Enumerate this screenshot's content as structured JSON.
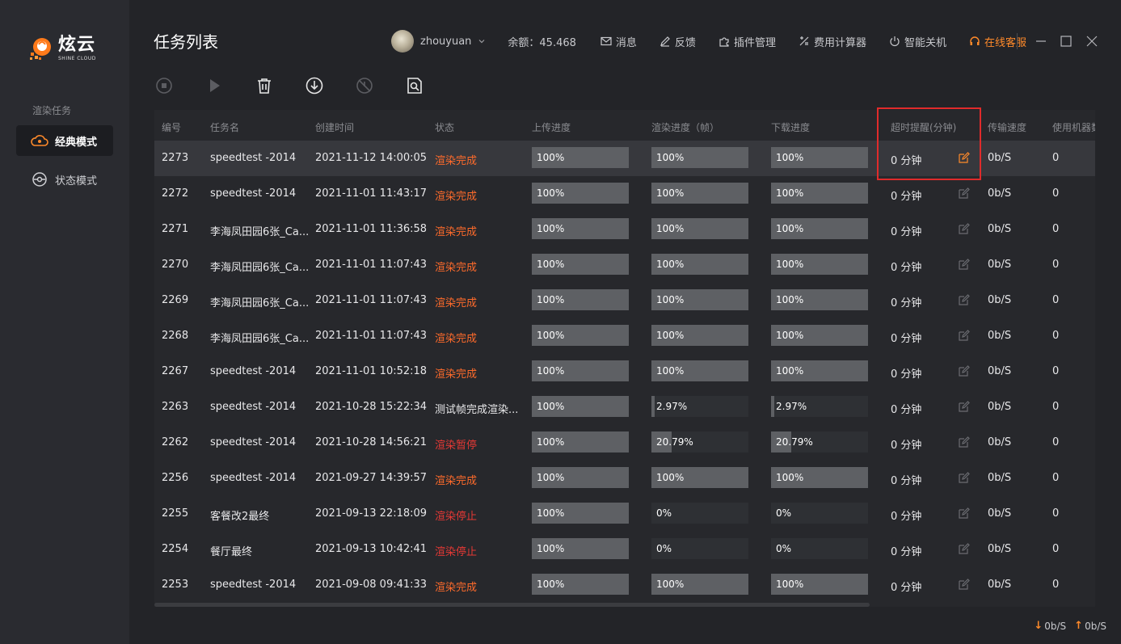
{
  "brand": {
    "name_cn": "炫云",
    "name_en": "SHINE CLOUD"
  },
  "sidebar": {
    "section_label": "渲染任务",
    "items": [
      {
        "label": "经典模式",
        "icon": "cloud-icon",
        "active": true
      },
      {
        "label": "状态模式",
        "icon": "dashboard-icon",
        "active": false
      }
    ]
  },
  "header": {
    "title": "任务列表",
    "user": "zhouyuan",
    "balance": "余额：45.468",
    "nav": [
      {
        "label": "消息",
        "icon": "mail-icon"
      },
      {
        "label": "反馈",
        "icon": "pen-icon"
      },
      {
        "label": "插件管理",
        "icon": "puzzle-icon"
      },
      {
        "label": "费用计算器",
        "icon": "calculator-icon"
      },
      {
        "label": "智能关机",
        "icon": "power-icon"
      },
      {
        "label": "在线客服",
        "icon": "headset-icon"
      }
    ],
    "accent_color": "#ff8a2a"
  },
  "toolbar": [
    "stop-icon",
    "play-icon",
    "trash-icon",
    "download-icon",
    "disabled-icon",
    "search-file-icon"
  ],
  "table": {
    "columns": [
      "编号",
      "任务名",
      "创建时间",
      "状态",
      "上传进度",
      "渲染进度（帧）",
      "下载进度",
      "超时提醒(分钟)",
      "传输速度",
      "使用机器数"
    ],
    "rows": [
      {
        "id": "2273",
        "name": "speedtest -2014",
        "created": "2021-11-12 14:00:05",
        "status": "渲染完成",
        "status_type": "done",
        "upload": "100%",
        "upload_pct": 100,
        "render": "100%",
        "render_pct": 100,
        "download": "100%",
        "download_pct": 100,
        "timeout": "0 分钟",
        "speed": "0b/S",
        "machines": "0",
        "selected": true
      },
      {
        "id": "2272",
        "name": "speedtest -2014",
        "created": "2021-11-01 11:43:17",
        "status": "渲染完成",
        "status_type": "done",
        "upload": "100%",
        "upload_pct": 100,
        "render": "100%",
        "render_pct": 100,
        "download": "100%",
        "download_pct": 100,
        "timeout": "0 分钟",
        "speed": "0b/S",
        "machines": "0"
      },
      {
        "id": "2271",
        "name": "李海凤田园6张_Ca...",
        "created": "2021-11-01 11:36:58",
        "status": "渲染完成",
        "status_type": "done",
        "upload": "100%",
        "upload_pct": 100,
        "render": "100%",
        "render_pct": 100,
        "download": "100%",
        "download_pct": 100,
        "timeout": "0 分钟",
        "speed": "0b/S",
        "machines": "0"
      },
      {
        "id": "2270",
        "name": "李海凤田园6张_Ca...",
        "created": "2021-11-01 11:07:43",
        "status": "渲染完成",
        "status_type": "done",
        "upload": "100%",
        "upload_pct": 100,
        "render": "100%",
        "render_pct": 100,
        "download": "100%",
        "download_pct": 100,
        "timeout": "0 分钟",
        "speed": "0b/S",
        "machines": "0"
      },
      {
        "id": "2269",
        "name": "李海凤田园6张_Ca...",
        "created": "2021-11-01 11:07:43",
        "status": "渲染完成",
        "status_type": "done",
        "upload": "100%",
        "upload_pct": 100,
        "render": "100%",
        "render_pct": 100,
        "download": "100%",
        "download_pct": 100,
        "timeout": "0 分钟",
        "speed": "0b/S",
        "machines": "0"
      },
      {
        "id": "2268",
        "name": "李海凤田园6张_Ca...",
        "created": "2021-11-01 11:07:43",
        "status": "渲染完成",
        "status_type": "done",
        "upload": "100%",
        "upload_pct": 100,
        "render": "100%",
        "render_pct": 100,
        "download": "100%",
        "download_pct": 100,
        "timeout": "0 分钟",
        "speed": "0b/S",
        "machines": "0"
      },
      {
        "id": "2267",
        "name": "speedtest -2014",
        "created": "2021-11-01 10:52:18",
        "status": "渲染完成",
        "status_type": "done",
        "upload": "100%",
        "upload_pct": 100,
        "render": "100%",
        "render_pct": 100,
        "download": "100%",
        "download_pct": 100,
        "timeout": "0 分钟",
        "speed": "0b/S",
        "machines": "0"
      },
      {
        "id": "2263",
        "name": "speedtest -2014",
        "created": "2021-10-28 15:22:34",
        "status": "测试帧完成渲染...",
        "status_type": "other",
        "upload": "100%",
        "upload_pct": 100,
        "render": "2.97%",
        "render_pct": 2.97,
        "download": "2.97%",
        "download_pct": 2.97,
        "timeout": "0 分钟",
        "speed": "0b/S",
        "machines": "0"
      },
      {
        "id": "2262",
        "name": "speedtest -2014",
        "created": "2021-10-28 14:56:21",
        "status": "渲染暂停",
        "status_type": "stop",
        "upload": "100%",
        "upload_pct": 100,
        "render": "20.79%",
        "render_pct": 20.79,
        "download": "20.79%",
        "download_pct": 20.79,
        "timeout": "0 分钟",
        "speed": "0b/S",
        "machines": "0"
      },
      {
        "id": "2256",
        "name": "speedtest -2014",
        "created": "2021-09-27 14:39:57",
        "status": "渲染完成",
        "status_type": "done",
        "upload": "100%",
        "upload_pct": 100,
        "render": "100%",
        "render_pct": 100,
        "download": "100%",
        "download_pct": 100,
        "timeout": "0 分钟",
        "speed": "0b/S",
        "machines": "0"
      },
      {
        "id": "2255",
        "name": "客餐改2最终",
        "created": "2021-09-13 22:18:09",
        "status": "渲染停止",
        "status_type": "stop",
        "upload": "100%",
        "upload_pct": 100,
        "render": "0%",
        "render_pct": 0,
        "download": "0%",
        "download_pct": 0,
        "timeout": "0 分钟",
        "speed": "0b/S",
        "machines": "0"
      },
      {
        "id": "2254",
        "name": "餐厅最终",
        "created": "2021-09-13 10:42:41",
        "status": "渲染停止",
        "status_type": "stop",
        "upload": "100%",
        "upload_pct": 100,
        "render": "0%",
        "render_pct": 0,
        "download": "0%",
        "download_pct": 0,
        "timeout": "0 分钟",
        "speed": "0b/S",
        "machines": "0"
      },
      {
        "id": "2253",
        "name": "speedtest -2014",
        "created": "2021-09-08 09:41:33",
        "status": "渲染完成",
        "status_type": "done",
        "upload": "100%",
        "upload_pct": 100,
        "render": "100%",
        "render_pct": 100,
        "download": "100%",
        "download_pct": 100,
        "timeout": "0 分钟",
        "speed": "0b/S",
        "machines": "0"
      }
    ]
  },
  "footer": {
    "download_speed": "0b/S",
    "upload_speed": "0b/S"
  }
}
